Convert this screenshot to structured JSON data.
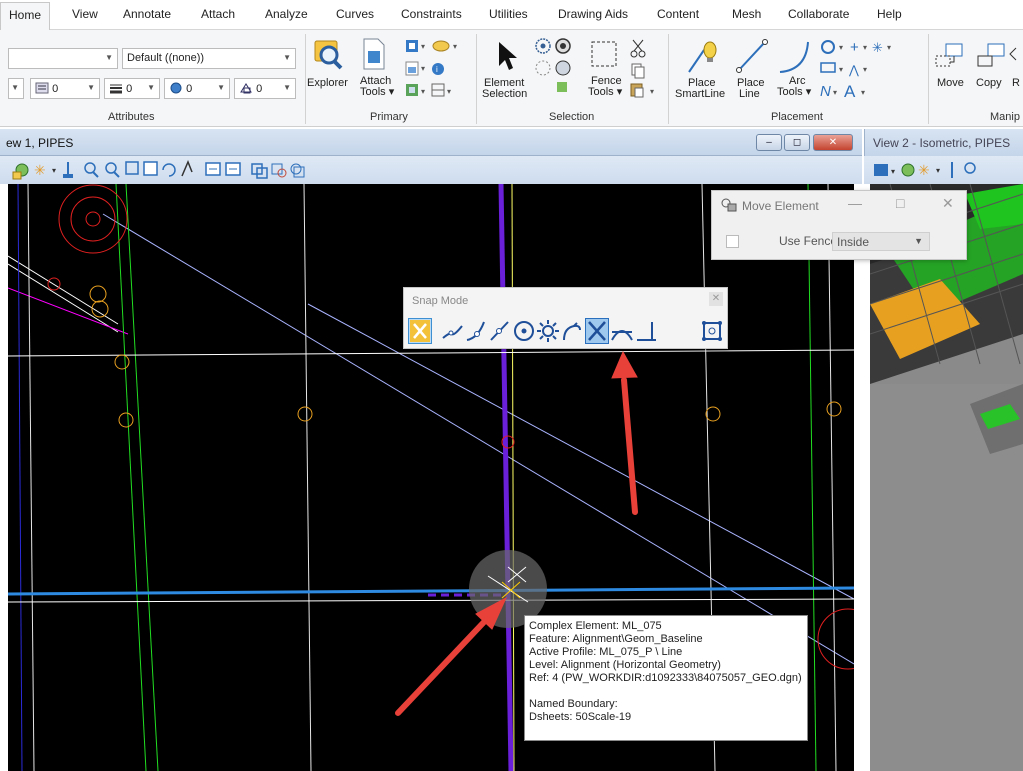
{
  "ribbon": {
    "tabs": [
      "Home",
      "View",
      "Annotate",
      "Attach",
      "Analyze",
      "Curves",
      "Constraints",
      "Utilities",
      "Drawing Aids",
      "Content",
      "Mesh",
      "Collaborate",
      "Help"
    ],
    "attributes": {
      "group_label": "Attributes",
      "style_combo": "Default ((none))",
      "weight_value": "0",
      "line_value": "0",
      "color_value": "0",
      "trans_value": "0"
    },
    "primary": {
      "group_label": "Primary",
      "explorer": "Explorer",
      "attach_tools_1": "Attach",
      "attach_tools_2": "Tools ▾"
    },
    "selection": {
      "group_label": "Selection",
      "element_selection_1": "Element",
      "element_selection_2": "Selection",
      "fence_tools_1": "Fence",
      "fence_tools_2": "Tools ▾"
    },
    "placement": {
      "group_label": "Placement",
      "place_smartline_1": "Place",
      "place_smartline_2": "SmartLine",
      "place_line_1": "Place",
      "place_line_2": "Line",
      "arc_tools_1": "Arc",
      "arc_tools_2": "Tools ▾"
    },
    "manipulate": {
      "group_label": "Manip",
      "move": "Move",
      "copy": "Copy",
      "more": "R"
    }
  },
  "view1": {
    "title": "ew 1, PIPES"
  },
  "view2": {
    "title": "View 2 - Isometric, PIPES"
  },
  "move_dialog": {
    "title": "Move Element",
    "use_fence_label": "Use Fence:",
    "fence_mode": "Inside"
  },
  "snap_mode": {
    "title": "Snap Mode",
    "buttons": [
      "keypoint-snap",
      "nearest-snap",
      "midpoint-snap",
      "bisector-snap",
      "center-snap",
      "origin-snap",
      "tangent-snap",
      "intersection-snap",
      "perpendicular-snap",
      "parallel-snap",
      "through-point-snap"
    ],
    "active_index": 7
  },
  "tooltip": {
    "line1": "Complex Element: ML_075",
    "line2": "Feature: Alignment\\Geom_Baseline",
    "line3": "Active Profile: ML_075_P \\ Line",
    "line4": "Level: Alignment (Horizontal Geometry)",
    "line5": "Ref: 4 (PW_WORKDIR:d1092333\\84075057_GEO.dgn)",
    "line6": "Named Boundary:",
    "line7": "Dsheets: 50Scale-19"
  },
  "colors": {
    "annotation_arrow": "#e8413a",
    "selected_blue": "#3d8fd1",
    "canvas_background": "#000000"
  }
}
